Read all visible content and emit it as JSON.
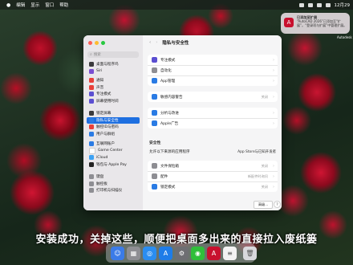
{
  "menubar": {
    "items": [
      "",
      "编辑",
      "显示",
      "窗口",
      "帮助"
    ],
    "time": "12月29"
  },
  "notification": {
    "title": "已添加至扩展",
    "body": "“AutoCAD 2026”已添加至“扩展”。“登录项与扩展”中管理扩展。",
    "app_label": "Autodesk"
  },
  "window": {
    "title": "隐私与安全性",
    "nav_back": "‹",
    "nav_forward": "›",
    "search_placeholder": "搜索",
    "sidebar": [
      {
        "label": "桌面与程序坞",
        "color": "#3a3a3c"
      },
      {
        "label": "Siri",
        "color": "#7a4fd1"
      },
      {
        "label": "通知",
        "color": "#e8403a"
      },
      {
        "label": "声音",
        "color": "#e8403a"
      },
      {
        "label": "专注模式",
        "color": "#5b4fd1"
      },
      {
        "label": "屏幕使用时间",
        "color": "#5b4fd1"
      },
      {
        "label": "锁定屏幕",
        "color": "#3a3a3c"
      },
      {
        "label": "隐私与安全性",
        "color": "#2a7be4",
        "selected": true
      },
      {
        "label": "触控ID与密码",
        "color": "#e8403a"
      },
      {
        "label": "用户与群组",
        "color": "#2a7be4"
      },
      {
        "label": "互联网账户",
        "color": "#2a7be4"
      },
      {
        "label": "Game Center",
        "color": "#ffffff"
      },
      {
        "label": "iCloud",
        "color": "#3ea2f3"
      },
      {
        "label": "钱包与 Apple Pay",
        "color": "#222222"
      },
      {
        "label": "键盘",
        "color": "#8e8e93"
      },
      {
        "label": "触控板",
        "color": "#8e8e93"
      },
      {
        "label": "打印机与扫描仪",
        "color": "#8e8e93"
      }
    ],
    "card1": [
      {
        "label": "专注模式",
        "color": "#5b4fd1",
        "value": ""
      },
      {
        "label": "自动化",
        "color": "#8e8e93",
        "value": ""
      },
      {
        "label": "App管理",
        "color": "#2a7be4",
        "value": ""
      }
    ],
    "card2": [
      {
        "label": "敏感内容警告",
        "color": "#2a7be4",
        "value": "关闭"
      }
    ],
    "card3": [
      {
        "label": "分析与改进",
        "color": "#2a7be4",
        "value": ""
      },
      {
        "label": "Apple广告",
        "color": "#2a7be4",
        "value": ""
      }
    ],
    "security_heading": "安全性",
    "allow_label": "允许以下来源的应用程序",
    "allow_value": "App Store与已知开发者",
    "card4": [
      {
        "label": "文件保险箱",
        "color": "#8e8e93",
        "value": "关闭"
      },
      {
        "label": "配件",
        "color": "#8e8e93",
        "value": "新配件时询问"
      },
      {
        "label": "锁定模式",
        "color": "#2a7be4",
        "value": "关闭"
      }
    ],
    "advanced_button": "高级...",
    "help_button": "?"
  },
  "caption": "安装成功，关掉这些，顺便把桌面多出来的直接拉入废纸篓",
  "dock": [
    {
      "name": "finder",
      "color": "#3b7be8",
      "glyph": "☺"
    },
    {
      "name": "launchpad",
      "color": "#8e8e93",
      "glyph": "▦"
    },
    {
      "name": "safari",
      "color": "#2a8df0",
      "glyph": "◎"
    },
    {
      "name": "app-store",
      "color": "#1e7ce8",
      "glyph": "A"
    },
    {
      "name": "settings",
      "color": "#6e6e73",
      "glyph": "⚙"
    },
    {
      "name": "wechat",
      "color": "#2fbf3a",
      "glyph": "◉"
    },
    {
      "name": "autocad",
      "color": "#c8102e",
      "glyph": "A"
    },
    {
      "name": "notes",
      "color": "#f2f2f2",
      "glyph": "≡"
    },
    {
      "name": "trash",
      "color": "#d8d8dc",
      "glyph": "🗑"
    }
  ]
}
